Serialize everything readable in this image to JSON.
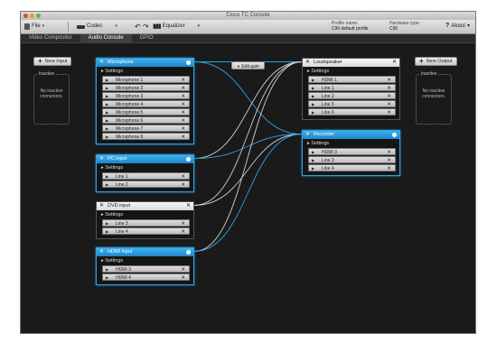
{
  "window": {
    "title": "Cisco TC Console"
  },
  "toolbar": {
    "file": "File",
    "codec": "Codec",
    "equalizer": "Equalizer",
    "profile_label": "Profile name:",
    "profile_value": "C90 default profile",
    "hardware_label": "Hardware type:",
    "hardware_value": "C90",
    "about": "About"
  },
  "tabs": [
    "Video Compositor",
    "Audio Console",
    "GPIO"
  ],
  "left": {
    "new_input": "New Input",
    "inactive_label": "Inactive",
    "inactive_text": "No inactive connectors."
  },
  "right": {
    "new_output": "New Output",
    "inactive_label": "Inactive",
    "inactive_text": "No inactive connectors."
  },
  "edit_gain": "Edit gain",
  "settings_label": "Settings",
  "inputs": [
    {
      "name": "Microphone",
      "style": "blue",
      "rows": [
        "Microphone 1",
        "Microphone 2",
        "Microphone 3",
        "Microphone 4",
        "Microphone 5",
        "Microphone 6",
        "Microphone 7",
        "Microphone 8"
      ]
    },
    {
      "name": "PC input",
      "style": "blue",
      "rows": [
        "Line 1",
        "Line 2"
      ]
    },
    {
      "name": "DVD input",
      "style": "white",
      "rows": [
        "Line 3",
        "Line 4"
      ]
    },
    {
      "name": "HDMI input",
      "style": "blue",
      "rows": [
        "HDMI 3",
        "HDMI 4"
      ]
    }
  ],
  "outputs": [
    {
      "name": "Loudspeaker",
      "style": "white",
      "rows": [
        "HDMI 1",
        "Line 1",
        "Line 2",
        "Line 5",
        "Line 6"
      ]
    },
    {
      "name": "Recorder",
      "style": "blue",
      "rows": [
        "HDMI 3",
        "Line 3",
        "Line 4"
      ]
    }
  ],
  "colors": {
    "accent": "#29a3e3",
    "wire_white": "#cfcfcf"
  }
}
